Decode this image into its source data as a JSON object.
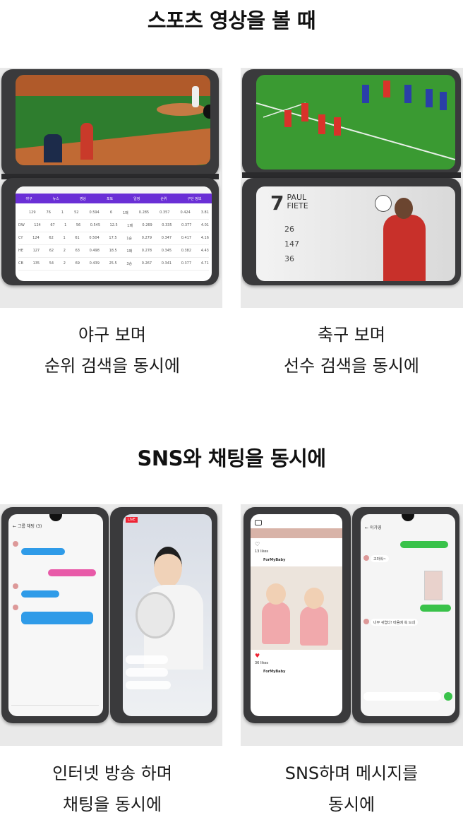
{
  "section1": {
    "title": "스포츠 영상을 볼 때",
    "items": [
      {
        "caption_line1": "야구 보며",
        "caption_line2": "순위 검색을 동시에"
      },
      {
        "caption_line1": "축구 보며",
        "caption_line2": "선수 검색을 동시에"
      }
    ]
  },
  "section2": {
    "title": "SNS와 채팅을 동시에",
    "items": [
      {
        "caption_line1": "인터넷 방송 하며",
        "caption_line2": "채팅을 동시에"
      },
      {
        "caption_line1": "SNS하며 메시지를",
        "caption_line2": "동시에"
      }
    ]
  },
  "baseball_table": {
    "headers": [
      "야구",
      "뉴스",
      "영상",
      "포토",
      "일정",
      "순위",
      "구단 정보"
    ],
    "rows": [
      [
        "",
        "129",
        "76",
        "1",
        "52",
        "0.594",
        "6",
        "1패",
        "0.285",
        "0.357",
        "0.424",
        "3.81"
      ],
      [
        "DW",
        "124",
        "67",
        "1",
        "56",
        "0.545",
        "12.5",
        "1패",
        "0.269",
        "0.335",
        "0.377",
        "4.01"
      ],
      [
        "CY",
        "124",
        "62",
        "1",
        "61",
        "0.504",
        "17.5",
        "1승",
        "0.279",
        "0.347",
        "0.417",
        "4.16"
      ],
      [
        "HE",
        "127",
        "62",
        "2",
        "63",
        "0.498",
        "18.5",
        "1패",
        "0.278",
        "0.345",
        "0.382",
        "4.43"
      ],
      [
        "CB",
        "135",
        "54",
        "2",
        "69",
        "0.439",
        "25.5",
        "3승",
        "0.267",
        "0.341",
        "0.377",
        "4.71"
      ]
    ]
  },
  "player_card": {
    "number": "7",
    "first_name": "PAUL",
    "last_name": "FIETE",
    "stats": [
      "26",
      "147",
      "36"
    ]
  },
  "group_chat": {
    "title": "그룹 채팅 (3)"
  },
  "live_badge": "LIVE",
  "sns": {
    "likes_top": "13 likes",
    "user": "ForMyBaby",
    "likes_bottom": "36 likes",
    "user2": "ForMyBaby"
  },
  "messenger": {
    "contact": "이가영",
    "msg1": "고마워~",
    "msg2": "너무 귀엽다! 마음에 쏙 드네"
  },
  "colors": {
    "table_header": "#6a2fd6",
    "pitch_green": "#2f8a2f",
    "chat_blue": "#2f9be8",
    "chat_pink": "#e85aa8",
    "msg_green": "#39c24a"
  }
}
